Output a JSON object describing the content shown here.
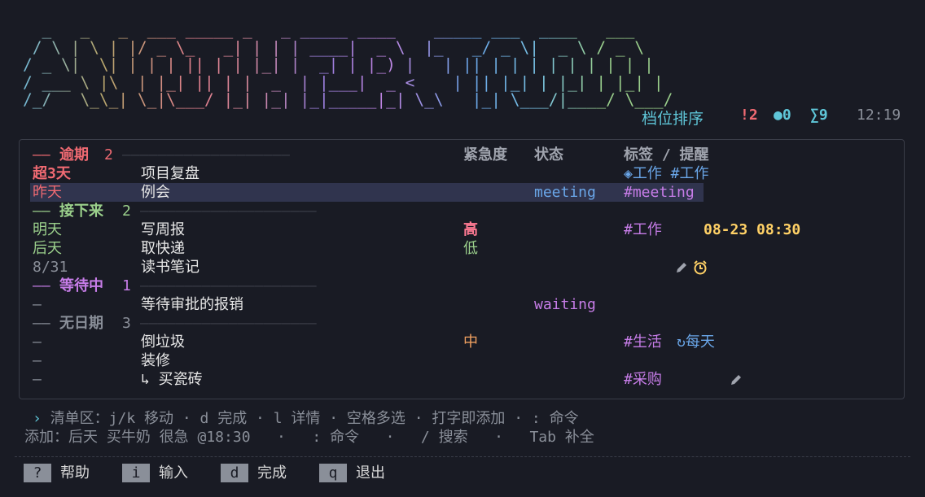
{
  "banner": {
    "text": "  _   _   _  ___ _____ _   _ _____ ____    _____ ___  ____   ___  \n / \\ | \\ | |/ _ \\_   _| | | | ____|  _ \\  |_   _/ _ \\|  _ \\ / _ \\ \n/ _ \\|  \\| | | | || | | |_| |  _| | |_) |   | || | | | | | | | | |\n/ ___ \\ |\\  | |_| || | |  _  | |___|  _ <    | || |_| | |_| | |_| |\n/_/   \\_\\_| \\_|\\___/ |_| |_| |_|_____|_| \\_\\   |_| \\___/|____/ \\___/ "
  },
  "status": {
    "sort_mode": "档位排序",
    "overdue": "!2",
    "waiting": "●0",
    "total": "∑9",
    "time": "12:19"
  },
  "columns": {
    "urgency": "紧急度",
    "state": "状态",
    "tags": "标签 / 提醒"
  },
  "groups": {
    "overdue": {
      "dash": "—— ",
      "name": "逾期",
      "count": "2",
      "rule": "———————————————————"
    },
    "upcoming": {
      "dash": "—— ",
      "name": "接下来",
      "count": "2",
      "rule": "————————————————————"
    },
    "waiting": {
      "dash": "—— ",
      "name": "等待中",
      "count": "1",
      "rule": "————————————————————"
    },
    "nodate": {
      "dash": "—— ",
      "name": "无日期",
      "count": "3",
      "rule": "————————————————————"
    }
  },
  "tasks": [
    {
      "date": "超3天",
      "title": "项目复盘",
      "urgency": "",
      "state": "",
      "tags": "◈工作 #工作"
    },
    {
      "date": "昨天",
      "title": "例会",
      "urgency": "",
      "state": "meeting",
      "tags": "#meeting"
    },
    {
      "date": "明天",
      "title": "写周报",
      "urgency": "高",
      "state": "",
      "tags": "#工作",
      "reminder": "08-23 08:30"
    },
    {
      "date": "后天",
      "title": "取快递",
      "urgency": "低",
      "state": "",
      "tags": ""
    },
    {
      "date": "8/31",
      "title": "读书笔记",
      "urgency": "",
      "state": "",
      "tags": ""
    },
    {
      "date": "—",
      "title": "等待审批的报销",
      "urgency": "",
      "state": "waiting",
      "tags": ""
    },
    {
      "date": "—",
      "title": "倒垃圾",
      "urgency": "中",
      "state": "",
      "tags": "#生活",
      "repeat": "↻每天"
    },
    {
      "date": "—",
      "title": "装修",
      "urgency": "",
      "state": "",
      "tags": ""
    },
    {
      "date": "—",
      "title": "↳ 买瓷砖",
      "urgency": "",
      "state": "",
      "tags": "#采购"
    }
  ],
  "hints": {
    "arrow": "›",
    "line1": "清单区：j/k 移动 · d 完成 · l 详情 · 空格多选 · 打字即添加 · : 命令",
    "line2": "添加：后天 买牛奶 很急 @18:30   ·   : 命令   ·   / 搜索   ·   Tab 补全"
  },
  "keys": [
    {
      "key": "?",
      "label": "帮助"
    },
    {
      "key": "i",
      "label": "输入"
    },
    {
      "key": "d",
      "label": "完成"
    },
    {
      "key": "q",
      "label": "退出"
    }
  ],
  "colors": {
    "background": "#191b24",
    "overdue": "#f06a72",
    "upcoming": "#9bd08c",
    "waiting": "#c77de8",
    "accent": "#5fc6d8",
    "selection": "#30344e"
  }
}
